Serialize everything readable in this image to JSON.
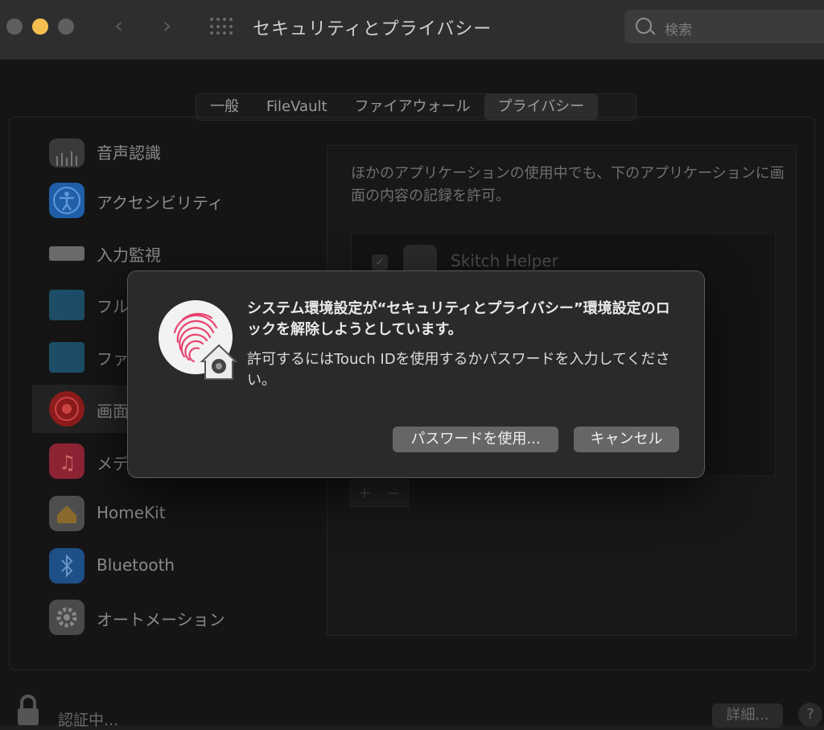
{
  "window": {
    "title": "セキュリティとプライバシー",
    "search_placeholder": "検索"
  },
  "tabs": [
    {
      "label": "一般",
      "active": false
    },
    {
      "label": "FileVault",
      "active": false
    },
    {
      "label": "ファイアウォール",
      "active": false
    },
    {
      "label": "プライバシー",
      "active": true
    }
  ],
  "sidebar": {
    "items": [
      {
        "label": "音声認識",
        "icon": "microphone-waveform-icon"
      },
      {
        "label": "アクセシビリティ",
        "icon": "accessibility-icon"
      },
      {
        "label": "入力監視",
        "icon": "keyboard-icon"
      },
      {
        "label": "フル",
        "icon": "folder-icon"
      },
      {
        "label": "ファ",
        "icon": "folder-icon"
      },
      {
        "label": "画面",
        "icon": "screen-recording-icon",
        "selected": true
      },
      {
        "label": "メデ",
        "icon": "music-icon"
      },
      {
        "label": "HomeKit",
        "icon": "homekit-icon"
      },
      {
        "label": "Bluetooth",
        "icon": "bluetooth-icon"
      },
      {
        "label": "オートメーション",
        "icon": "gear-icon"
      }
    ]
  },
  "right_pane": {
    "description": "ほかのアプリケーションの使用中でも、下のアプリケーションに画面の内容の記録を許可。",
    "apps": [
      {
        "name": "Skitch Helper",
        "checked": true
      }
    ],
    "add_label": "+",
    "remove_label": "−"
  },
  "footer": {
    "status": "認証中...",
    "details_label": "詳細...",
    "help_label": "?"
  },
  "dialog": {
    "title": "システム環境設定が“セキュリティとプライバシー”環境設定のロックを解除しようとしています。",
    "message": "許可するにはTouch IDを使用するかパスワードを入力してください。",
    "use_password_label": "パスワードを使用...",
    "cancel_label": "キャンセル"
  },
  "colors": {
    "traffic_close": "#5f5f5f",
    "traffic_minimize": "#f5bf4f",
    "traffic_zoom": "#5f5f5f",
    "fingerprint": "#e8436f"
  }
}
